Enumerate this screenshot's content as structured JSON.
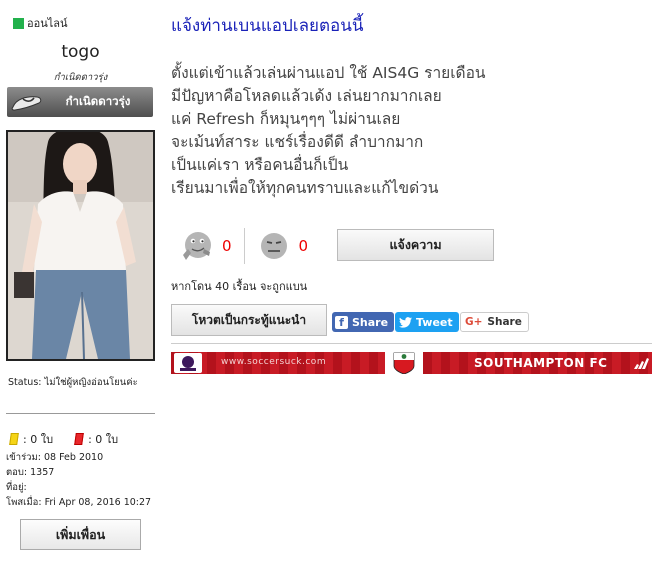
{
  "profile": {
    "online_label": "ออนไลน์",
    "username": "togo",
    "rank_text": "กำเนิดดาวรุ่ง",
    "rank_badge_label": "กำเนิดดาวรุ่ง",
    "status": "Status: ไม่ใช่ผู้หญิงอ่อนโยนค่ะ",
    "yellow_cards": ": 0 ใบ",
    "red_cards": ": 0 ใบ",
    "joined": "เข้าร่วม: 08 Feb 2010",
    "replies": "ตอบ: 1357",
    "location": "ที่อยู่:",
    "last_post": "โพสเมื่อ: Fri Apr 08, 2016 10:27",
    "add_friend_label": "เพิ่มเพื่อน"
  },
  "post": {
    "title": "แจ้งท่านเบนแอปเลยตอนนี้",
    "body_lines": [
      "ตั้งแต่เข้าแล้วเล่นผ่านแอป ใช้ AIS4G รายเดือน",
      "มีปัญหาคือโหลดแล้วเด้ง เล่นยากมากเลย",
      "แค่ Refresh ก็หมุนๆๆๆ ไม่ผ่านเลย",
      "จะเม้นท์สาระ แชร์เรื่องดีดี ลำบากมาก",
      "เป็นแค่เรา หรือคนอื่นก็เป็น",
      "เรียนมาเพื่อให้ทุกคนทราบและแก้ไขด่วน"
    ]
  },
  "actions": {
    "like_count": "0",
    "dislike_count": "0",
    "report_label": "แจ้งความ",
    "ban_note": "หากโดน 40 เรื้อน จะถูกแบน",
    "vote_label": "โหวตเป็นกระทู้แนะนำ",
    "fb_share_label": "Share",
    "tweet_label": "Tweet",
    "gplus_share_label": "Share"
  },
  "banner": {
    "site": "www.soccersuck.com",
    "team": "SOUTHAMPTON  FC"
  },
  "colors": {
    "title": "#1a22b8",
    "count": "#e00000",
    "online": "#22b14c",
    "facebook": "#4267b2",
    "twitter": "#1da1f2",
    "banner": "#c81b25"
  }
}
